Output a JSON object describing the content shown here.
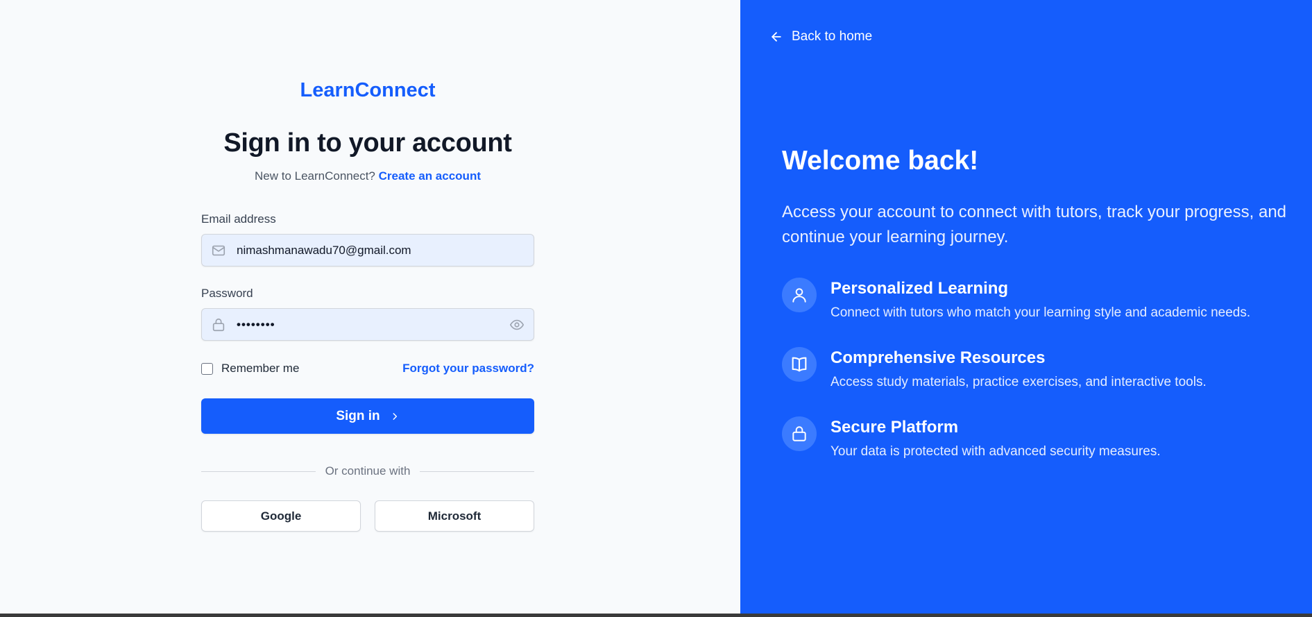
{
  "left": {
    "brand": "LearnConnect",
    "heading": "Sign in to your account",
    "subline_prefix": "New to LearnConnect?",
    "create_account_link": "Create an account",
    "email": {
      "label": "Email address",
      "value": "nimashmanawadu70@gmail.com",
      "icon": "mail-icon"
    },
    "password": {
      "label": "Password",
      "value": "••••••••",
      "icon": "lock-icon",
      "toggle_icon": "eye-icon"
    },
    "remember_label": "Remember me",
    "remember_checked": false,
    "forgot_link": "Forgot your password?",
    "signin_button": "Sign in",
    "divider_text": "Or continue with",
    "oauth": {
      "google": "Google",
      "microsoft": "Microsoft"
    }
  },
  "right": {
    "back_link": "Back to home",
    "welcome": "Welcome back!",
    "intro": "Access your account to connect with tutors, track your progress, and continue your learning journey.",
    "features": [
      {
        "icon": "user-icon",
        "title": "Personalized Learning",
        "description": "Connect with tutors who match your learning style and academic needs."
      },
      {
        "icon": "book-icon",
        "title": "Comprehensive Resources",
        "description": "Access study materials, practice exercises, and interactive tools."
      },
      {
        "icon": "lock-icon",
        "title": "Secure Platform",
        "description": "Your data is protected with advanced security measures."
      }
    ]
  },
  "colors": {
    "primary": "#155dfc",
    "background": "#f8fafc",
    "input_fill": "#e8f0fe"
  }
}
